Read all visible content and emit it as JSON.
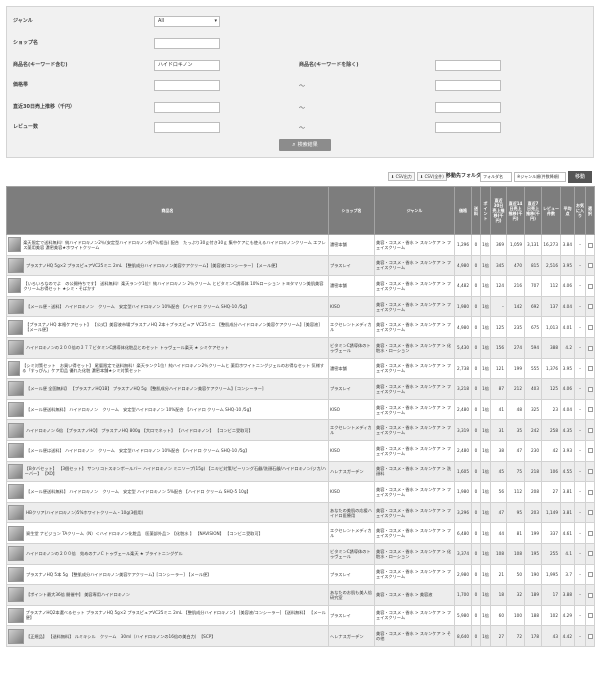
{
  "form": {
    "genre_label": "ジャンル",
    "genre_value": "All",
    "shop_label": "ショップ名",
    "shop_value": "",
    "product_label": "商品名(キーワード含む)",
    "product_value": "ハイドロキノン",
    "exclude_label": "商品名(キーワードを除く)",
    "exclude_value": "",
    "price_label": "価格帯",
    "sales_label": "直近30日売上推移（千円）",
    "review_label": "レビュー数",
    "tilde": "～",
    "search_button": "検索結果"
  },
  "toolbar": {
    "csv_button": "CSV出力",
    "csv_all_button": "CSV(全件)",
    "folder_label": "移動先フォルダ",
    "folder_select": "フォルダ名",
    "order_select": "※ジャンル順(件数降順)",
    "go_button": "移動"
  },
  "table": {
    "headers": [
      "商品名",
      "ショップ名",
      "ジャンル",
      "価格",
      "送料",
      "ポイント",
      "直近30日売上推移(千円)",
      "直近14日売上推移(千円)",
      "直近7日売上推移(千円)",
      "レビュー件数",
      "平均点",
      "お気に入り",
      "選択"
    ],
    "rows": [
      {
        "name": "楽天限定で送料無料！純ハイドロキノン2％(安定型ハイドロキノン約7％相当) 配合　たっぷり30ｇ付き30ｇ 集中ケアにも使えるハイドロキノンクリーム エフレス薬用美容 濃密美容★ホワイトクリーム",
        "shop": "濃密本舗",
        "genre": "美容・コスメ・香水 > スキンケア > フェイスクリーム",
        "price": "1,296",
        "shipping": "0",
        "point": "1倍",
        "s30": "369",
        "s14": "1,059",
        "s7": "3,131",
        "reviews": "16,273",
        "avg": "3.84",
        "fav": "–"
      },
      {
        "name": "プラスナノHQ 5g×2 プラスピュアVC25ミニ 2mL 【整肌成分ハイドロキノン美容ケアクリーム】[美容液/コンシーラー] 【メール便】",
        "shop": "プラスレイ",
        "genre": "美容・コスメ・香水 > スキンケア > フェイスクリーム",
        "price": "4,980",
        "shipping": "0",
        "point": "1倍",
        "s30": "345",
        "s14": "470",
        "s7": "815",
        "reviews": "2,516",
        "avg": "3.95",
        "fav": "–"
      },
      {
        "name": "【いろいろなのでよ　の公開待ちです】 送料無料！楽天ランク1位！純ハイドロキノン 2％クリーム とビタミンC誘導体 10%ローション トヨタマリン美肌美容クリームお得セット ★シミ・そばかす",
        "shop": "濃密本舗",
        "genre": "美容・コスメ・香水 > スキンケア > フェイスクリーム",
        "price": "4,482",
        "shipping": "0",
        "point": "1倍",
        "s30": "124",
        "s14": "216",
        "s7": "707",
        "reviews": "112",
        "avg": "4.06",
        "fav": "–"
      },
      {
        "name": "【メール便・送料】 ハイドロキノン　クリーム　安定型ハイドロキノン 10%配合 【ハイドロ クリーム SHQ-10 /5g】",
        "shop": "KISO",
        "genre": "美容・コスメ・香水 > スキンケア > フェイスクリーム",
        "price": "1,980",
        "shipping": "0",
        "point": "1倍",
        "s30": "–",
        "s14": "142",
        "s7": "692",
        "reviews": "137",
        "avg": "4.04",
        "fav": "–"
      },
      {
        "name": "【プラスナノHQ 本格ケアセット】 【公式】美容液市場プラスナノHQ 2本＋プラスピュア VC25ミニ 【整肌成分ハイドロキノン美容ケアクリーム】[美容液] 【メール便】",
        "shop": "エクセレントメディカル",
        "genre": "美容・コスメ・香水 > スキンケア > フェイスクリーム",
        "price": "4,980",
        "shipping": "0",
        "point": "1倍",
        "s30": "125",
        "s14": "235",
        "s7": "675",
        "reviews": "1,013",
        "avg": "4.01",
        "fav": "–"
      },
      {
        "name": "ハイドロキノンの２００倍の３７７ビタミンC誘導体化粧品とのセット トゥヴェール楽天 ★ シミケアセット",
        "shop": "ビタミンC誘導体のトゥヴェール",
        "genre": "美容・コスメ・香水 > スキンケア > 化粧水・ローション",
        "price": "5,430",
        "shipping": "0",
        "point": "1倍",
        "s30": "156",
        "s14": "274",
        "s7": "594",
        "reviews": "388",
        "avg": "4.2",
        "fav": "–"
      },
      {
        "name": "【シミ対策セット　お買い得セット】 尾暦限定で送料無料！楽天ランク1位！純ハイドロキノン2％クリームと 薬用ホワイトニングジェルのお得なセット 気様する「すっぴん」ケア用品 優れた化粧 濃密本舗★シミ対策セット",
        "shop": "濃密本舗",
        "genre": "美容・コスメ・香水 > スキンケア > フェイスクリーム",
        "price": "2,738",
        "shipping": "0",
        "point": "1倍",
        "s30": "121",
        "s14": "199",
        "s7": "555",
        "reviews": "1,376",
        "avg": "3.95",
        "fav": "–"
      },
      {
        "name": "【メール便 全国無料】 【プラスナノHQ1B】 プラスナノHQ 5g 【整肌成分ハイドロキノン美容ケアクリーム】[コンシーラー]",
        "shop": "プラスレイ",
        "genre": "美容・コスメ・香水 > スキンケア > フェイスクリーム",
        "price": "3,218",
        "shipping": "0",
        "point": "1倍",
        "s30": "87",
        "s14": "212",
        "s7": "403",
        "reviews": "125",
        "avg": "4.06",
        "fav": "–"
      },
      {
        "name": "【メール便送料無料】 ハイドロキノン　クリーム　安定型ハイドロキノン 10%配合 【ハイドロ クリーム SHQ-10 /5g】",
        "shop": "KISO",
        "genre": "美容・コスメ・香水 > スキンケア > フェイスクリーム",
        "price": "2,480",
        "shipping": "0",
        "point": "1倍",
        "s30": "41",
        "s14": "48",
        "s7": "325",
        "reviews": "23",
        "avg": "4.04",
        "fav": "–"
      },
      {
        "name": "ハイドロキノン 6倍 【プラスナノHQ】 プラスナノHQ 800g 【大口でネット】 【ハイドロキノン】 【コンビニ受取可】",
        "shop": "エクセレントメディカル",
        "genre": "美容・コスメ・香水 > スキンケア > フェイスクリーム",
        "price": "3,319",
        "shipping": "0",
        "point": "1倍",
        "s30": "31",
        "s14": "35",
        "s7": "242",
        "reviews": "258",
        "avg": "4.35",
        "fav": "–"
      },
      {
        "name": "【メール便は送料】 ハイドロキノン　クリーム　安定型ハイドロキノン 10%配合 【ハイドロ クリーム SHQ-10 /5g】",
        "shop": "KISO",
        "genre": "美容・コスメ・香水 > スキンケア > フェイスクリーム",
        "price": "2,480",
        "shipping": "0",
        "point": "1倍",
        "s30": "38",
        "s14": "47",
        "s7": "230",
        "reviews": "42",
        "avg": "3.93",
        "fav": "–"
      },
      {
        "name": "【Bタバセット】 【3個セット】 サンリコトスキンポールバー ハイドロキノン ミニソープ(15g) 【ニキビ対策/ピーリング石鹸/洗顔石鹸/ハイドロキノン/ジカ/ハーバー】 【XO】",
        "shop": "ハレナスガーデン",
        "genre": "美容・コスメ・香水 > スキンケア > 洗顔料",
        "price": "1,605",
        "shipping": "0",
        "point": "1倍",
        "s30": "45",
        "s14": "75",
        "s7": "218",
        "reviews": "106",
        "avg": "4.55",
        "fav": "–"
      },
      {
        "name": "【メール便送料無料】 ハイドロキノン　クリーム　安定型 ハイドロキノン 5%配合 【ハイドロ クリーム SHQ-5 10g】",
        "shop": "KISO",
        "genre": "美容・コスメ・香水 > スキンケア > フェイスクリーム",
        "price": "1,980",
        "shipping": "0",
        "point": "1倍",
        "s30": "56",
        "s14": "112",
        "s7": "208",
        "reviews": "27",
        "avg": "3.81",
        "fav": "–"
      },
      {
        "name": "HBクリア(ハイドロキノン)5%ホワイトクリーム・10g(3個用)",
        "shop": "あなたの美肌の応援ハイドロ医療用",
        "genre": "美容・コスメ・香水 > スキンケア > フェイスクリーム",
        "price": "3,296",
        "shipping": "0",
        "point": "1倍",
        "s30": "47",
        "s14": "95",
        "s7": "203",
        "reviews": "1,149",
        "avg": "3.81",
        "fav": "–"
      },
      {
        "name": "資生堂 ナビジョン TAクリーム（N）＜ハイドロキノン化粧品　医薬部外品＞ 【化粧水 】 【NAVISION】 【コンビニ受取可】",
        "shop": "エクセレントメディカル",
        "genre": "美容・コスメ・香水 > スキンケア > フェイスクリーム",
        "price": "6,480",
        "shipping": "0",
        "point": "1倍",
        "s30": "44",
        "s14": "81",
        "s7": "199",
        "reviews": "337",
        "avg": "4.61",
        "fav": "–"
      },
      {
        "name": "ハイドロキノンの２００倍　効めのナノC トゥヴェール楽天 ★ ブライトニングゲル",
        "shop": "ビタミンC誘導体のトゥヴェール",
        "genre": "美容・コスメ・香水 > スキンケア > 化粧水・ローション",
        "price": "3,374",
        "shipping": "0",
        "point": "1倍",
        "s30": "108",
        "s14": "108",
        "s7": "195",
        "reviews": "255",
        "avg": "4.1",
        "fav": "–"
      },
      {
        "name": "プラスナノHQ 5本 5g 【整肌成分ハイドロキノン美容ケアクリーム】[コンシーラー] 【メール便】",
        "shop": "プラスレイ",
        "genre": "美容・コスメ・香水 > スキンケア > フェイスクリーム",
        "price": "2,980",
        "shipping": "0",
        "point": "1倍",
        "s30": "21",
        "s14": "50",
        "s7": "190",
        "reviews": "1,995",
        "avg": "3.7",
        "fav": "–"
      },
      {
        "name": "【ポイント最大36倍 開催中】 美容専用ハイドロキノン",
        "shop": "あなたのお肌も美人倍研究室",
        "genre": "美容・コスメ・香水 > 美容液",
        "price": "1,700",
        "shipping": "0",
        "point": "1倍",
        "s30": "18",
        "s14": "32",
        "s7": "189",
        "reviews": "17",
        "avg": "3.88",
        "fav": "–"
      },
      {
        "name": "プラスナノHQ2本選べるセット プラスナノHQ 5g×2 プラスピュアVC25ミニ 2mL 【整肌成分ハイドロキノン】 [美容液/コンシーラー] 【送料無料】 【メール便】",
        "shop": "プラスレイ",
        "genre": "美容・コスメ・香水 > スキンケア > フェイスクリーム",
        "price": "5,980",
        "shipping": "0",
        "point": "1倍",
        "s30": "60",
        "s14": "100",
        "s7": "188",
        "reviews": "102",
        "avg": "4.29",
        "fav": "–"
      },
      {
        "name": "【正規品】 【送料無料】 ルミキシル　クリーム　30ml（ハイドロキノンの16倍の美白力）　【SCP】",
        "shop": "ヘレナスガーデン",
        "genre": "美容・コスメ・香水 > スキンケア > その他",
        "price": "8,640",
        "shipping": "0",
        "point": "1倍",
        "s30": "27",
        "s14": "72",
        "s7": "178",
        "reviews": "43",
        "avg": "4.42",
        "fav": "–"
      }
    ]
  }
}
